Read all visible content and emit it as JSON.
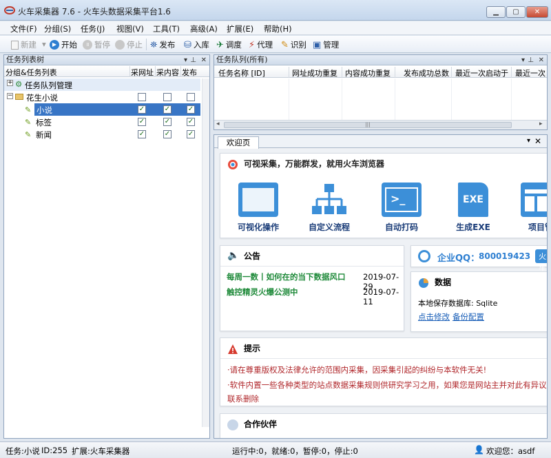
{
  "window": {
    "title": "火车采集器 7.6 - 火车头数据采集平台1.6"
  },
  "menu": [
    "文件(F)",
    "分组(S)",
    "任务(J)",
    "视图(V)",
    "工具(T)",
    "高级(A)",
    "扩展(E)",
    "帮助(H)"
  ],
  "toolbar": {
    "new": "新建",
    "start": "开始",
    "pause": "暂停",
    "stop": "停止",
    "publish": "发布",
    "import": "入库",
    "schedule": "调度",
    "proxy": "代理",
    "recognize": "识别",
    "manage": "管理"
  },
  "task_tree": {
    "title": "任务列表树",
    "columns": [
      "分组&任务列表",
      "采网址",
      "采内容",
      "发布"
    ],
    "rows": [
      {
        "label": "任务队列管理",
        "checks": []
      },
      {
        "label": "花生小说",
        "checks": [
          false,
          false,
          false
        ]
      },
      {
        "label": "小说",
        "checks": [
          true,
          true,
          true
        ],
        "selected": true
      },
      {
        "label": "标签",
        "checks": [
          true,
          true,
          true
        ]
      },
      {
        "label": "新闻",
        "checks": [
          true,
          true,
          true
        ]
      }
    ]
  },
  "queue": {
    "title": "任务队列(所有)",
    "columns": [
      "任务名称 [ID]",
      "网址成功重复",
      "内容成功重复",
      "发布成功总数",
      "最近一次启动于",
      "最近一次"
    ]
  },
  "welcome": {
    "tab": "欢迎页",
    "banner_title": "可视采集，万能群发，就用火车浏览器",
    "features": [
      "可视化操作",
      "自定义流程",
      "自动打码",
      "生成EXE",
      "项目管"
    ],
    "notice": {
      "title": "公告",
      "items": [
        {
          "text": "每周一数丨如何在的当下数据风口",
          "date": "2019-07-29"
        },
        {
          "text": "触控精灵火爆公测中",
          "date": "2019-07-11"
        }
      ]
    },
    "qq": {
      "label": "企业QQ：",
      "number": "800019423",
      "btn": "火车"
    },
    "data": {
      "title": "数据",
      "db_label": "本地保存数据库: Sqlite",
      "link1": "点击修改",
      "link2": "备份配置"
    },
    "tips": {
      "title": "提示",
      "lines": [
        "·请在尊重版权及法律允许的范围内采集，因采集引起的纠纷与本软件无关!",
        "·软件内置一些各种类型的站点数据采集规则供研究学习之用，如果您是网站主并对此有异议，请",
        "联系删除"
      ]
    },
    "partners": {
      "title": "合作伙伴"
    }
  },
  "status": {
    "task": "任务:小说",
    "id": "ID:255",
    "ext": "扩展:火车采集器",
    "run": "运行中:0，就绪:0，暂停:0，停止:0",
    "welcome": "欢迎您：asdf"
  },
  "colors": {
    "accent": "#3c8fd8",
    "green_link": "#1f8a3a",
    "warn_red": "#b0272b",
    "select_bg": "#3875c5"
  }
}
